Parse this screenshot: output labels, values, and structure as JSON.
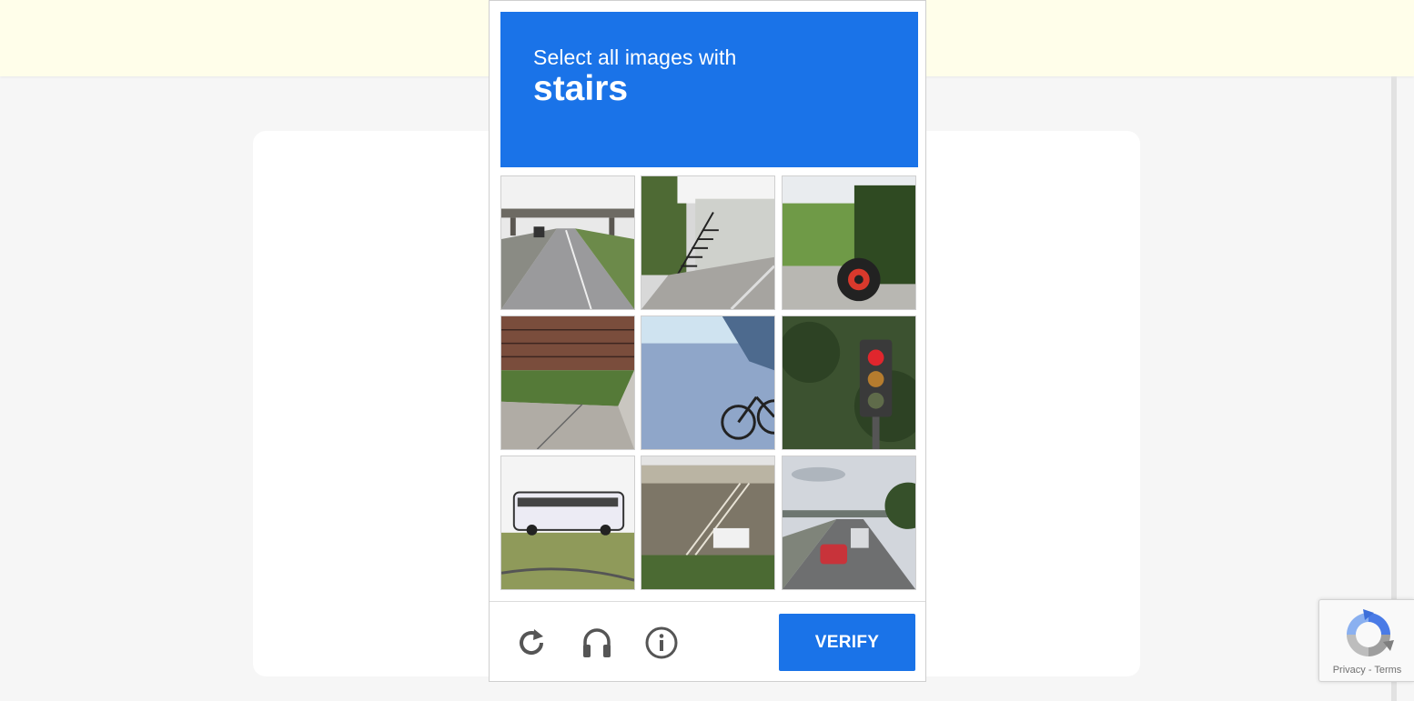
{
  "challenge": {
    "instruction": "Select all images with",
    "keyword": "stairs",
    "accent_color": "#1a73e8",
    "tiles": [
      {
        "icon": "road-overpass-image"
      },
      {
        "icon": "house-stairs-image"
      },
      {
        "icon": "tractor-image"
      },
      {
        "icon": "sidewalk-wall-image"
      },
      {
        "icon": "bicycle-image"
      },
      {
        "icon": "traffic-light-image"
      },
      {
        "icon": "bus-image"
      },
      {
        "icon": "building-stairs-image"
      },
      {
        "icon": "highway-cars-image"
      }
    ],
    "footer": {
      "reload_icon": "reload-icon",
      "audio_icon": "headphones-icon",
      "info_icon": "info-icon",
      "verify_label": "VERIFY"
    }
  },
  "badge": {
    "privacy_label": "Privacy",
    "separator": "-",
    "terms_label": "Terms"
  },
  "page": {
    "banner_color": "#fffeea",
    "background_color": "#f6f6f6"
  }
}
